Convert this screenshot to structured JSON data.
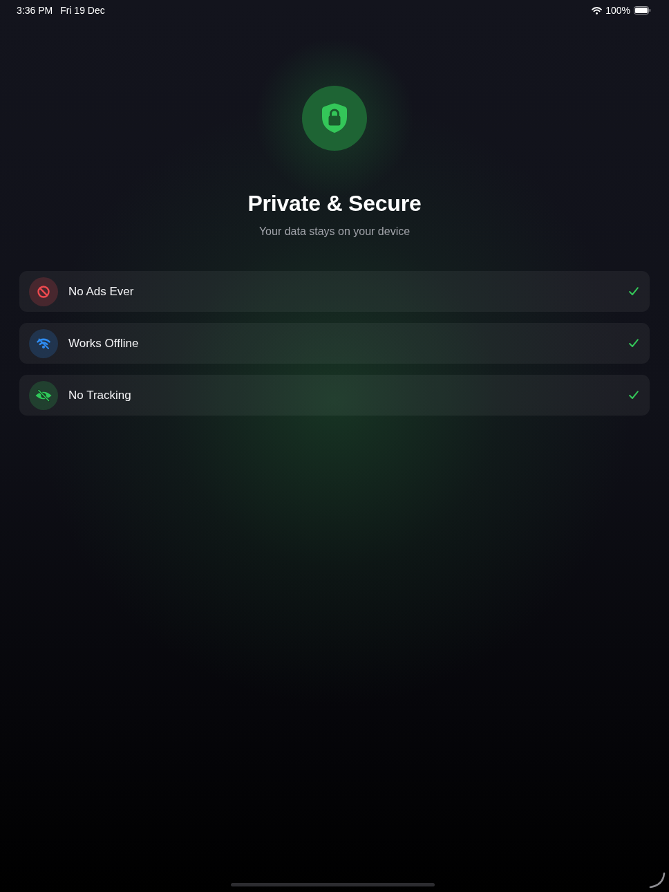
{
  "status_bar": {
    "time": "3:36 PM",
    "date": "Fri 19 Dec",
    "battery": "100%"
  },
  "header": {
    "title": "Private & Secure",
    "subtitle": "Your data stays on your device"
  },
  "features": [
    {
      "kind": "blocked",
      "label": "No Ads Ever",
      "color": "#ef4a4f",
      "checked": true
    },
    {
      "kind": "offline",
      "label": "Works Offline",
      "color": "#2f8cf2",
      "checked": true
    },
    {
      "kind": "hidden",
      "label": "No Tracking",
      "color": "#30c95a",
      "checked": true
    }
  ]
}
